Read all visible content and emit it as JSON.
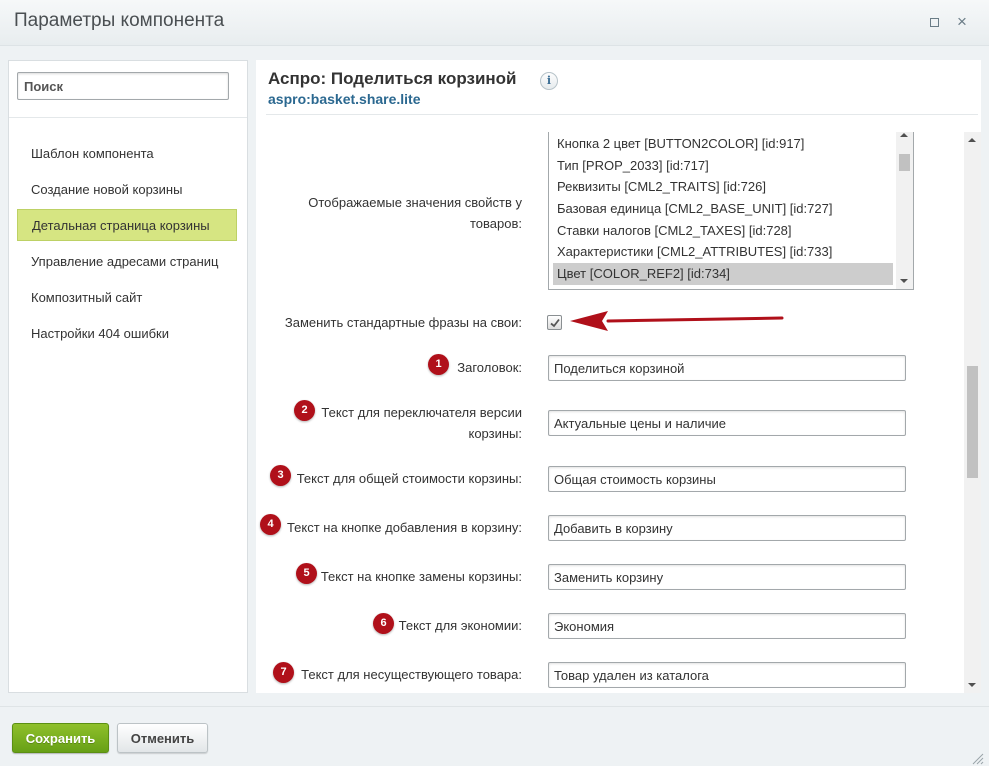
{
  "window": {
    "title": "Параметры компонента",
    "maximize_icon": "maximize-icon",
    "close_glyph": "×"
  },
  "sidebar": {
    "search_placeholder": "Поиск",
    "items": [
      {
        "label": "Шаблон компонента",
        "active": false
      },
      {
        "label": "Создание новой корзины",
        "active": false
      },
      {
        "label": "Детальная страница корзины",
        "active": true
      },
      {
        "label": "Управление адресами страниц",
        "active": false
      },
      {
        "label": "Композитный сайт",
        "active": false
      },
      {
        "label": "Настройки 404 ошибки",
        "active": false
      }
    ]
  },
  "component": {
    "title": "Аспро: Поделиться корзиной",
    "code": "aspro:basket.share.lite",
    "info_glyph": "i"
  },
  "fields": {
    "properties": {
      "label": "Отображаемые значения свойств у товаров:",
      "options": [
        "Кнопка 2 цвет [BUTTON2COLOR] [id:917]",
        "Тип [PROP_2033] [id:717]",
        "Реквизиты [CML2_TRAITS] [id:726]",
        "Базовая единица [CML2_BASE_UNIT] [id:727]",
        "Ставки налогов [CML2_TAXES] [id:728]",
        "Характеристики [CML2_ATTRIBUTES] [id:733]",
        "Цвет [COLOR_REF2] [id:734]"
      ],
      "selected": "Цвет [COLOR_REF2] [id:734]"
    },
    "replace_phrases": {
      "label": "Заменить стандартные фразы на свои:",
      "checked": true
    },
    "text_fields": [
      {
        "num": "1",
        "label": "Заголовок:",
        "value": "Поделиться корзиной"
      },
      {
        "num": "2",
        "label": "Текст для переключателя версии корзины:",
        "value": "Актуальные цены и наличие"
      },
      {
        "num": "3",
        "label": "Текст для общей стоимости корзины:",
        "value": "Общая стоимость корзины"
      },
      {
        "num": "4",
        "label": "Текст на кнопке добавления в корзину:",
        "value": "Добавить в корзину"
      },
      {
        "num": "5",
        "label": "Текст на кнопке замены корзины:",
        "value": "Заменить корзину"
      },
      {
        "num": "6",
        "label": "Текст для экономии:",
        "value": "Экономия"
      },
      {
        "num": "7",
        "label": "Текст для несуществующего товара:",
        "value": "Товар удален из каталога"
      }
    ]
  },
  "footer": {
    "save_label": "Сохранить",
    "cancel_label": "Отменить"
  },
  "colors": {
    "accent_green": "#6aa317",
    "active_item": "#d6e582",
    "annotation_red": "#b0101a",
    "link_blue": "#2b6890"
  }
}
